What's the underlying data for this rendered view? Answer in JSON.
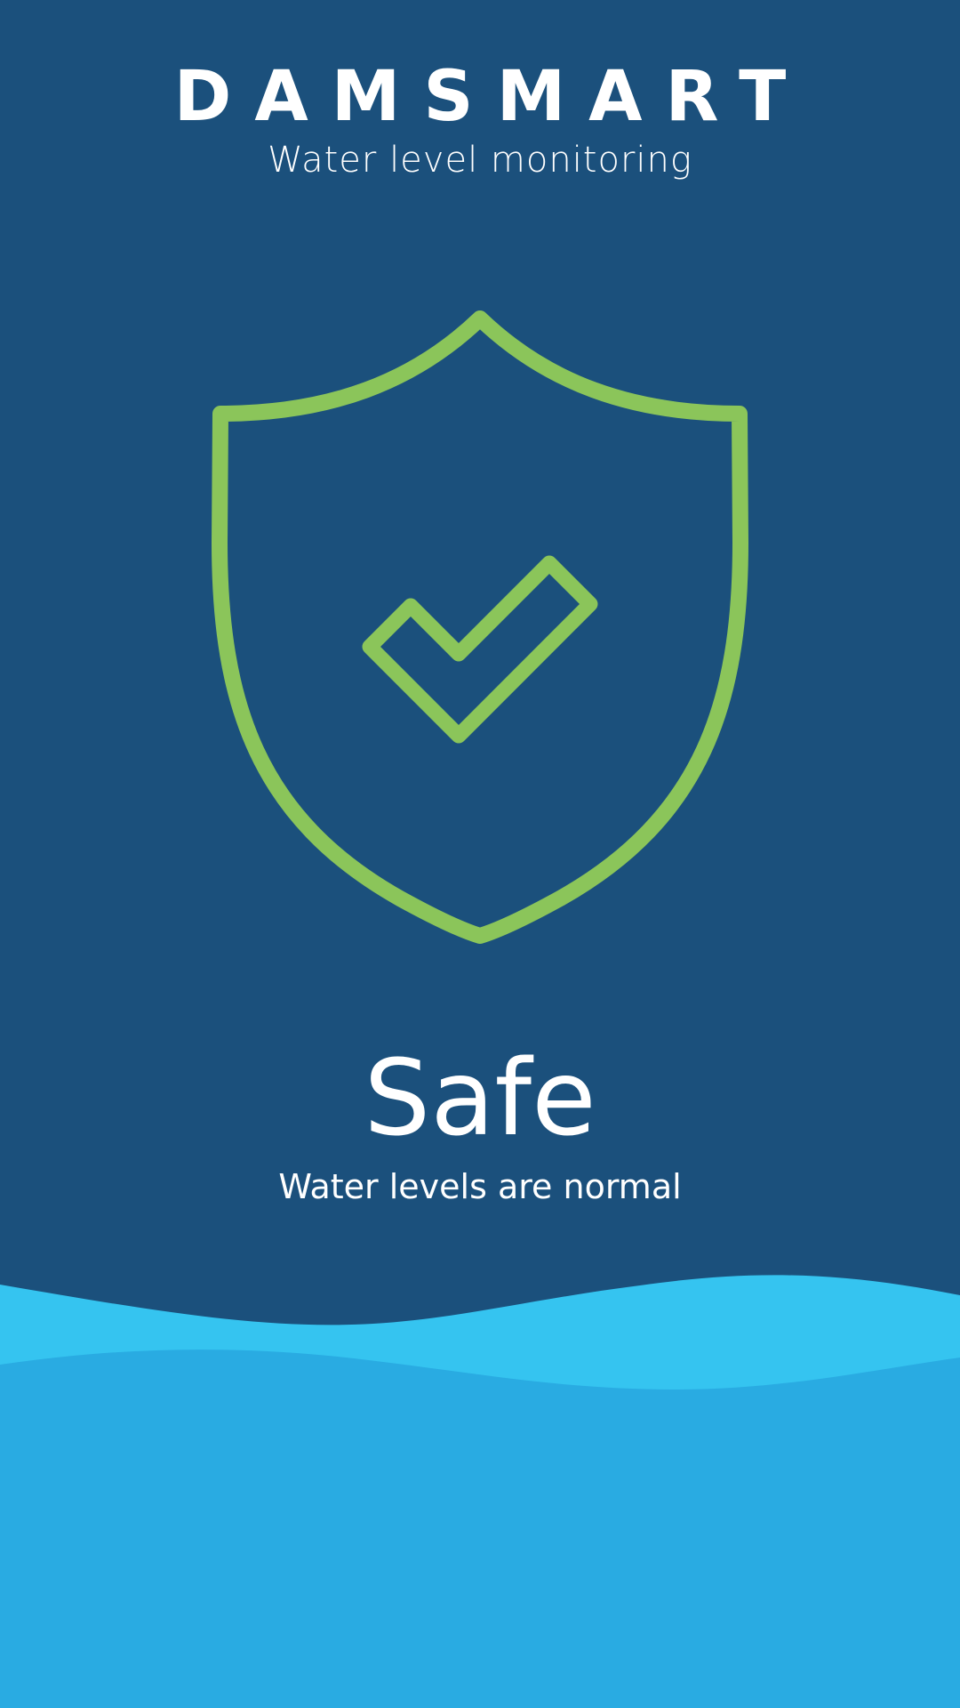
{
  "app": {
    "brand": "DAMSMART",
    "tagline": "Water level monitoring"
  },
  "status": {
    "title": "Safe",
    "description": "Water levels are normal",
    "icon": "shield-check-icon"
  },
  "colors": {
    "background": "#1b507c",
    "accent_green": "#8bc55a",
    "water_light": "#35c4f0",
    "water_main": "#29abe2",
    "text": "#ffffff"
  }
}
